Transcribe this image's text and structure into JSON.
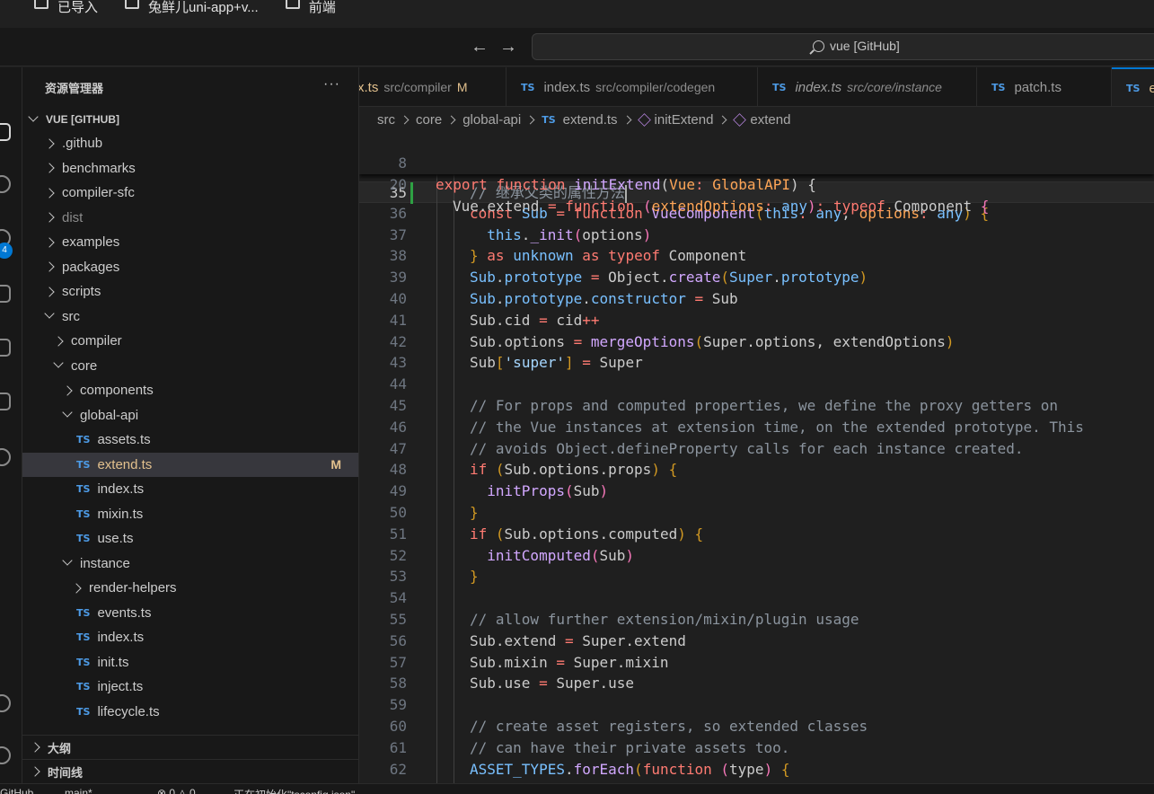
{
  "bookmarks": [
    {
      "label": "已导入"
    },
    {
      "label": "兔鲜儿uni-app+v..."
    },
    {
      "label": "前端"
    }
  ],
  "titlebar": {
    "back_icon": "arrow-left-icon",
    "forward_icon": "arrow-right-icon",
    "search_text": "vue [GitHub]"
  },
  "activity_bar": {
    "icons": [
      "explorer-icon",
      "search-icon",
      "source-control-icon",
      "run-debug-icon",
      "remote-explorer-icon",
      "extensions-icon",
      "github-icon",
      "account-icon",
      "settings-icon"
    ],
    "scm_badge": "4"
  },
  "sidebar": {
    "title": "资源管理器",
    "more": "···",
    "root": "VUE [GITHUB]",
    "items": [
      {
        "label": ".github",
        "kind": "folder"
      },
      {
        "label": "benchmarks",
        "kind": "folder"
      },
      {
        "label": "compiler-sfc",
        "kind": "folder"
      },
      {
        "label": "dist",
        "kind": "folder"
      },
      {
        "label": "examples",
        "kind": "folder"
      },
      {
        "label": "packages",
        "kind": "folder"
      },
      {
        "label": "scripts",
        "kind": "folder"
      },
      {
        "label": "src",
        "kind": "folder-open"
      },
      {
        "label": "compiler",
        "kind": "folder"
      },
      {
        "label": "core",
        "kind": "folder-open"
      },
      {
        "label": "components",
        "kind": "folder"
      },
      {
        "label": "global-api",
        "kind": "folder-open"
      },
      {
        "label": "assets.ts",
        "kind": "file"
      },
      {
        "label": "extend.ts",
        "kind": "file",
        "status": "M"
      },
      {
        "label": "index.ts",
        "kind": "file"
      },
      {
        "label": "mixin.ts",
        "kind": "file"
      },
      {
        "label": "use.ts",
        "kind": "file"
      },
      {
        "label": "instance",
        "kind": "folder-open"
      },
      {
        "label": "render-helpers",
        "kind": "folder"
      },
      {
        "label": "events.ts",
        "kind": "file"
      },
      {
        "label": "index.ts",
        "kind": "file"
      },
      {
        "label": "init.ts",
        "kind": "file"
      },
      {
        "label": "inject.ts",
        "kind": "file"
      },
      {
        "label": "lifecycle.ts",
        "kind": "file"
      }
    ],
    "ts_label": "TS",
    "outline": "大纲",
    "timeline": "时间线"
  },
  "tabs": [
    {
      "name": "x.ts",
      "desc": "src/compiler",
      "flag": "M",
      "badge": ""
    },
    {
      "name": "index.ts",
      "desc": "src/compiler/codegen",
      "flag": "",
      "badge": "TS"
    },
    {
      "name": "index.ts",
      "desc": "src/core/instance",
      "flag": "",
      "badge": "TS"
    },
    {
      "name": "patch.ts",
      "desc": "",
      "flag": "",
      "badge": "TS"
    },
    {
      "name": "e",
      "desc": "",
      "flag": "",
      "badge": "TS"
    }
  ],
  "breadcrumb": {
    "parts": [
      "src",
      "core",
      "global-api"
    ],
    "file_badge": "TS",
    "file": "extend.ts",
    "symbol1": "initExtend",
    "symbol2": "extend"
  },
  "editor": {
    "sticky": [
      {
        "n": "8"
      },
      {
        "n": "20"
      }
    ],
    "lines": [
      {
        "n": "35"
      },
      {
        "n": "36"
      },
      {
        "n": "37"
      },
      {
        "n": "38"
      },
      {
        "n": "39"
      },
      {
        "n": "40"
      },
      {
        "n": "41"
      },
      {
        "n": "42"
      },
      {
        "n": "43"
      },
      {
        "n": "44"
      },
      {
        "n": "45"
      },
      {
        "n": "46"
      },
      {
        "n": "47"
      },
      {
        "n": "48"
      },
      {
        "n": "49"
      },
      {
        "n": "50"
      },
      {
        "n": "51"
      },
      {
        "n": "52"
      },
      {
        "n": "53"
      },
      {
        "n": "54"
      },
      {
        "n": "55"
      },
      {
        "n": "56"
      },
      {
        "n": "57"
      },
      {
        "n": "58"
      },
      {
        "n": "59"
      },
      {
        "n": "60"
      },
      {
        "n": "61"
      },
      {
        "n": "62"
      }
    ]
  },
  "statusbar": {
    "remote": "GitHub",
    "branch": "main*",
    "problems": "⊗ 0 △ 0",
    "task": "正在初始化\"tsconfig.json\""
  },
  "colors": {
    "accent": "#0078d4",
    "modified": "#e2c08d",
    "ts_blue": "#4d9be6",
    "keyword": "#ff7b72",
    "function": "#d2a8ff",
    "type": "#ffa657",
    "variable": "#79c0ff",
    "comment": "#8b949e"
  }
}
